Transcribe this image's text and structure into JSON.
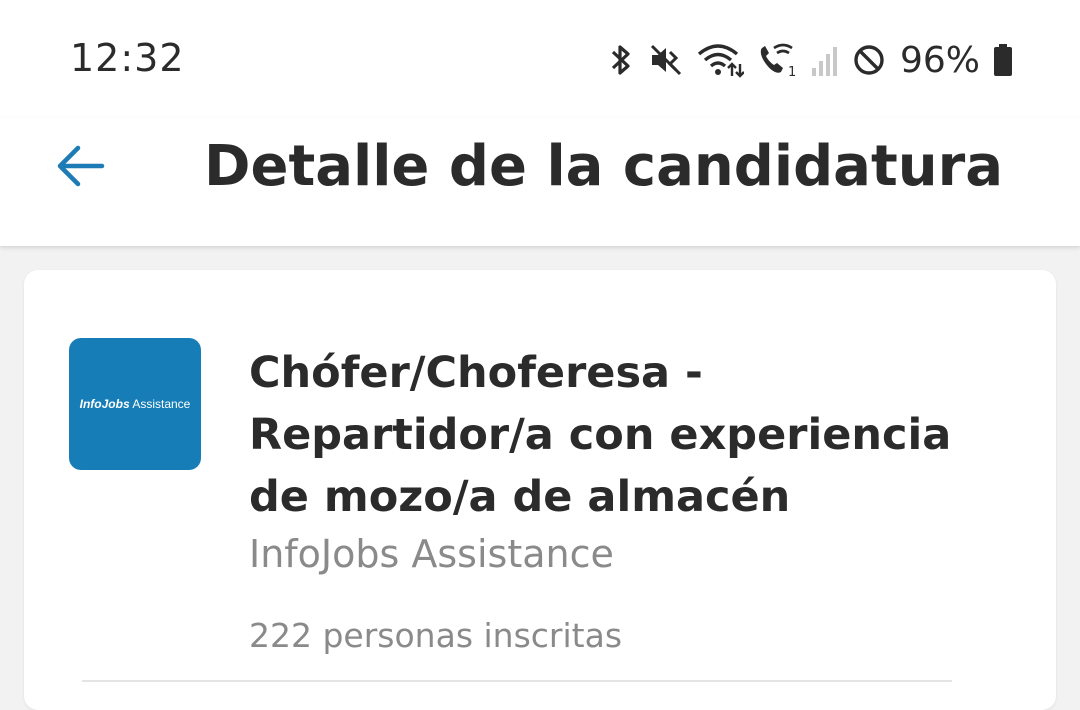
{
  "status_bar": {
    "time": "12:32",
    "battery_percent": "96%",
    "icons": [
      "bluetooth-icon",
      "vibrate-icon",
      "wifi-icon",
      "wifi-calling-icon",
      "signal-icon",
      "do-not-disturb-icon",
      "battery-icon"
    ]
  },
  "header": {
    "title": "Detalle de la candidatura",
    "back_icon": "arrow-left-icon"
  },
  "job": {
    "logo_brand": "InfoJobs",
    "logo_suffix": " Assistance",
    "title": "Chófer/Choferesa - Repartidor/a con experiencia de mozo/a de almacén",
    "company": "InfoJobs Assistance",
    "applicants": "222 personas inscritas"
  },
  "colors": {
    "accent": "#1d7bb6",
    "logo_bg": "#167db7",
    "text_primary": "#2b2b2b",
    "text_secondary": "#8a8a8a"
  }
}
